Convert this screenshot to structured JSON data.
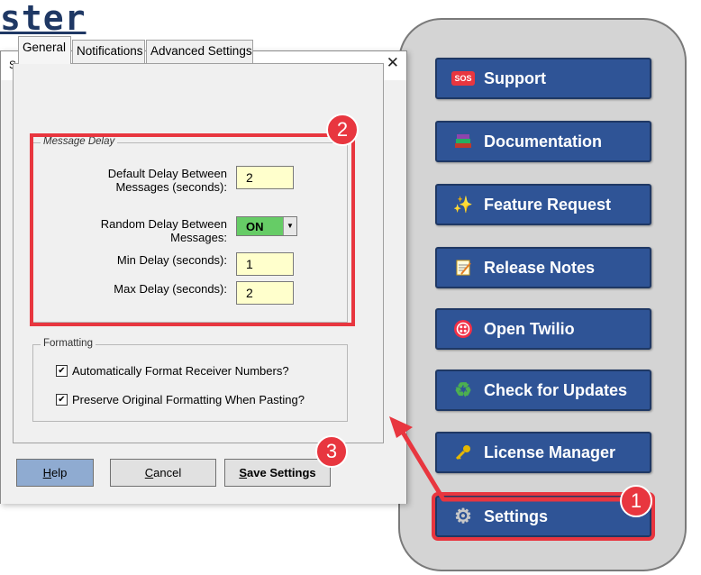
{
  "background": {
    "partial_title": "ster"
  },
  "sidebar": {
    "items": [
      {
        "label": "Support",
        "icon": "sos-icon",
        "icon_text": "SOS"
      },
      {
        "label": "Documentation",
        "icon": "books-icon"
      },
      {
        "label": "Feature Request",
        "icon": "sparkles-icon"
      },
      {
        "label": "Release Notes",
        "icon": "notepad-icon"
      },
      {
        "label": "Open Twilio",
        "icon": "twilio-icon"
      },
      {
        "label": "Check for Updates",
        "icon": "recycle-icon"
      },
      {
        "label": "License Manager",
        "icon": "key-icon"
      },
      {
        "label": "Settings",
        "icon": "gear-icon",
        "active": true
      }
    ]
  },
  "dialog": {
    "title": "Settings",
    "close_glyph": "✕",
    "tabs": [
      {
        "label": "General",
        "active": true
      },
      {
        "label": "Notifications"
      },
      {
        "label": "Advanced Settings"
      }
    ],
    "message_delay": {
      "legend": "Message Delay",
      "default_delay_label_line1": "Default Delay Between",
      "default_delay_label_line2": "Messages (seconds):",
      "default_delay_value": "2",
      "random_delay_label_line1": "Random Delay Between",
      "random_delay_label_line2": "Messages:",
      "random_delay_value": "ON",
      "min_delay_label": "Min Delay (seconds):",
      "min_delay_value": "1",
      "max_delay_label": "Max Delay (seconds):",
      "max_delay_value": "2"
    },
    "formatting": {
      "legend": "Formatting",
      "auto_format_label": "Automatically Format Receiver Numbers?",
      "auto_format_checked": true,
      "preserve_label": "Preserve Original Formatting When Pasting?",
      "preserve_checked": true
    },
    "buttons": {
      "help_underlined": "H",
      "help_rest": "elp",
      "cancel_underlined": "C",
      "cancel_rest": "ancel",
      "save_underlined": "S",
      "save_rest": "ave Settings"
    }
  },
  "annotations": {
    "badge_1": "1",
    "badge_2": "2",
    "badge_3": "3",
    "color": "#e8363f"
  }
}
